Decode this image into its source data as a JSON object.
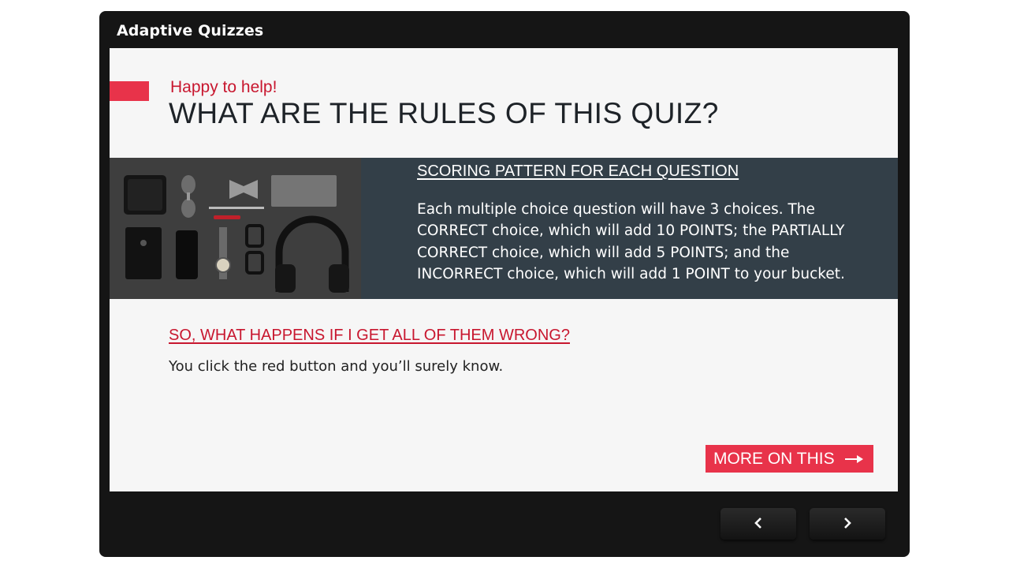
{
  "player": {
    "title": "Adaptive Quizzes"
  },
  "slide": {
    "subtitle": "Happy to help!",
    "title": "WHAT ARE THE RULES OF THIS QUIZ?",
    "scoring": {
      "heading": "SCORING PATTERN FOR EACH QUESTION",
      "text": "Each multiple choice question will have 3 choices. The CORRECT choice, which will add 10 POINTS; the PARTIALLY CORRECT choice, which will add 5 POINTS; and the INCORRECT choice, which will add 1 POINT to your bucket."
    },
    "wrong": {
      "heading": "SO, WHAT HAPPENS IF I GET ALL OF THEM WRONG?",
      "text": "You click the red button and you’ll surely know."
    },
    "more_button": {
      "label": "MORE ON THIS",
      "icon": "arrow-right-icon"
    }
  },
  "navigation": {
    "prev_icon": "chevron-left-icon",
    "next_icon": "chevron-right-icon"
  },
  "colors": {
    "accent": "#e8334a",
    "accent_text": "#c8172f",
    "band": "#333f48",
    "frame": "#151515"
  }
}
